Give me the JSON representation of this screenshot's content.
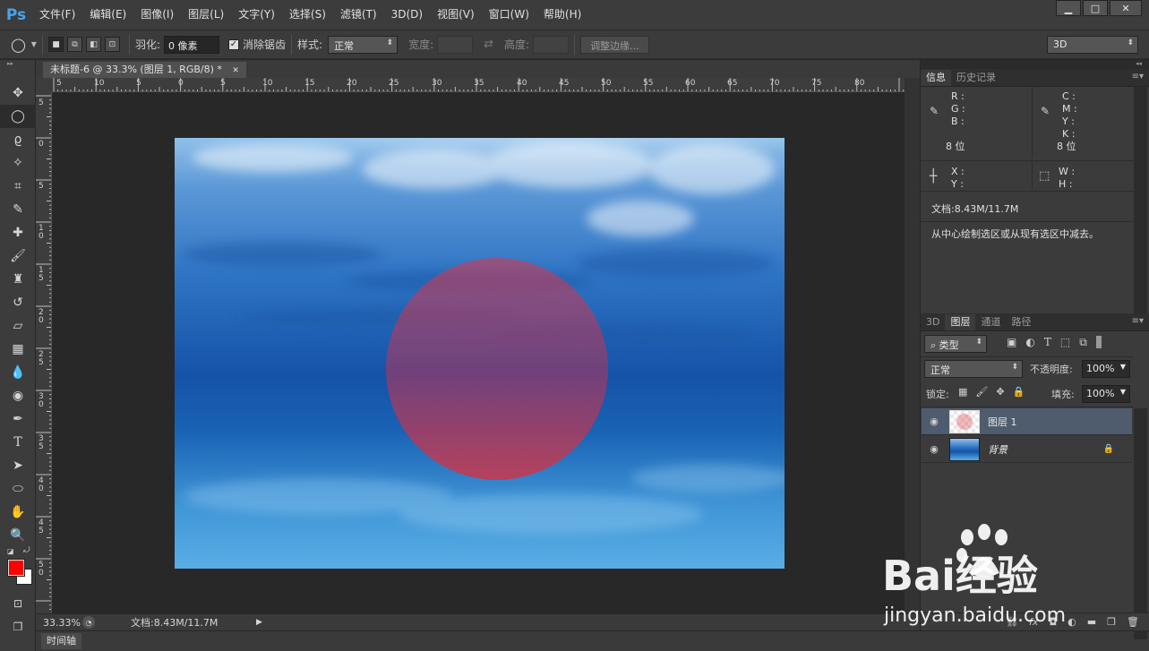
{
  "app": {
    "logo": "Ps"
  },
  "menubar": {
    "items": [
      "文件(F)",
      "编辑(E)",
      "图像(I)",
      "图层(L)",
      "文字(Y)",
      "选择(S)",
      "滤镜(T)",
      "3D(D)",
      "视图(V)",
      "窗口(W)",
      "帮助(H)"
    ]
  },
  "options": {
    "feather_label": "羽化:",
    "feather_value": "0 像素",
    "antialias_label": "消除锯齿",
    "antialias_checked": true,
    "style_label": "样式:",
    "style_value": "正常",
    "width_label": "宽度:",
    "height_label": "高度:",
    "refine_edge_label": "调整边缘...",
    "workspace_value": "3D"
  },
  "document": {
    "tab_title": "未标题-6 @ 33.3% (图层 1, RGB/8) *",
    "zoom": "33.33%",
    "doc_size": "文档:8.43M/11.7M",
    "ruler_top": [
      "5",
      "10",
      "5",
      "0",
      "5",
      "10",
      "15",
      "20",
      "25",
      "30",
      "35",
      "40",
      "45",
      "50",
      "55",
      "60",
      "65",
      "70",
      "75",
      "80"
    ],
    "ruler_left": [
      "5",
      "0",
      "5",
      "10",
      "15",
      "20",
      "25",
      "30",
      "35",
      "40",
      "45",
      "50"
    ]
  },
  "timeline": {
    "label": "时间轴"
  },
  "info_panel": {
    "tabs": [
      "信息",
      "历史记录"
    ],
    "rgb": [
      "R :",
      "G :",
      "B :"
    ],
    "cmyk": [
      "C :",
      "M :",
      "Y :",
      "K :"
    ],
    "bits_left": "8 位",
    "bits_right": "8 位",
    "xy": [
      "X :",
      "Y :"
    ],
    "wh": [
      "W :",
      "H :"
    ],
    "doc_size": "文档:8.43M/11.7M",
    "hint": "从中心绘制选区或从现有选区中减去。"
  },
  "layers_panel": {
    "tabs": [
      "3D",
      "图层",
      "通道",
      "路径"
    ],
    "filter_kind": "类型",
    "blend_mode": "正常",
    "opacity_label": "不透明度:",
    "opacity_value": "100%",
    "lock_label": "锁定:",
    "fill_label": "填充:",
    "fill_value": "100%",
    "layers": [
      {
        "name": "图层 1",
        "selected": true,
        "locked": false
      },
      {
        "name": "背景",
        "selected": false,
        "locked": true
      }
    ]
  },
  "colors": {
    "foreground": "#ff0000",
    "background": "#ffffff",
    "ps_blue": "#4aa3e8",
    "selected_layer": "#4f5c6e"
  },
  "watermark": {
    "brand": "Bai经验",
    "url": "jingyan.baidu.com"
  }
}
